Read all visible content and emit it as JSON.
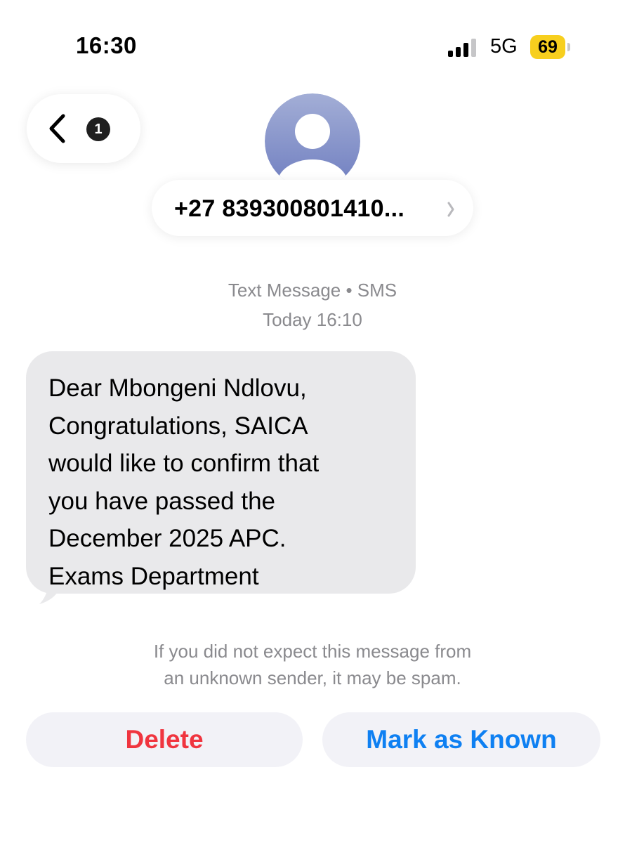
{
  "status_bar": {
    "time": "16:30",
    "network": "5G",
    "battery": "69",
    "signal_bars": 3,
    "signal_bars_total": 4
  },
  "nav": {
    "back_icon": "chevron-left-icon",
    "unread_count": "1"
  },
  "contact": {
    "avatar_icon": "person-icon",
    "number": "+27 839300801410...",
    "chevron_icon": "chevron-right-icon"
  },
  "conversation": {
    "service": "Text Message • SMS",
    "timestamp": "Today 16:10",
    "messages": [
      {
        "direction": "incoming",
        "lines": [
          "Dear Mbongeni Ndlovu,",
          "Congratulations, SAICA",
          "would like to confirm that",
          "you have passed the",
          "December 2025 APC.",
          "Exams Department"
        ]
      }
    ]
  },
  "spam_notice": {
    "line1": "If you did not expect this message from",
    "line2": "an unknown sender, it may be spam."
  },
  "actions": {
    "delete_label": "Delete",
    "mark_known_label": "Mark as Known"
  },
  "colors": {
    "battery": "#f7cf1e",
    "delete": "#f0353f",
    "mark_known": "#0f80f2",
    "bubble": "#e9e9eb",
    "button_bg": "#f2f2f7",
    "avatar_gradient_top": "#a3aed6",
    "avatar_gradient_bottom": "#6f7ec0"
  }
}
